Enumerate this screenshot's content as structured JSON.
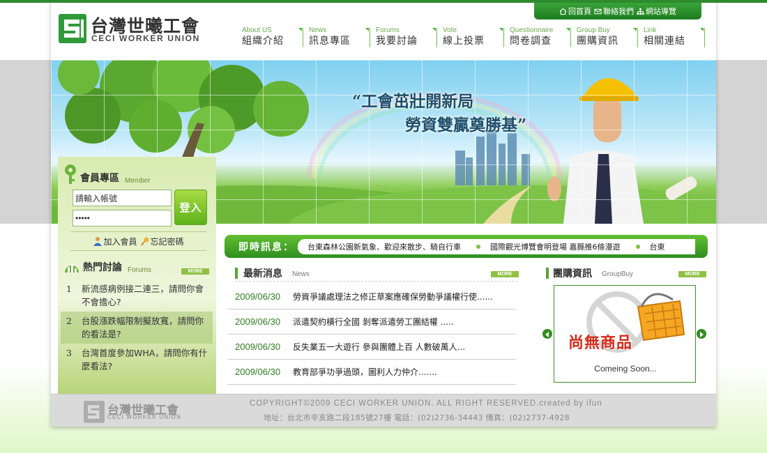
{
  "header": {
    "logo_title": "台灣世曦工會",
    "logo_subtitle": "CECI WORKER UNION",
    "top_links": [
      {
        "label": "回首頁",
        "icon": "home-icon"
      },
      {
        "label": "聯絡我們",
        "icon": "mail-icon"
      },
      {
        "label": "網站導覽",
        "icon": "sitemap-icon"
      }
    ],
    "nav": [
      {
        "en": "About US",
        "zh": "組織介紹"
      },
      {
        "en": "News",
        "zh": "訊息專區"
      },
      {
        "en": "Forums",
        "zh": "我要討論"
      },
      {
        "en": "Vote",
        "zh": "線上投票"
      },
      {
        "en": "Questionnaire",
        "zh": "問卷調查"
      },
      {
        "en": "Group Buy",
        "zh": "團購資訊"
      },
      {
        "en": "Link",
        "zh": "相關連結"
      }
    ]
  },
  "banner": {
    "slogan_line1": "“工會茁壯開新局",
    "slogan_line2": "勞資雙贏奠勝基”"
  },
  "member": {
    "title": "會員專區",
    "title_en": "Member",
    "account_value": "請輸入帳號",
    "password_value": "•••••",
    "login_label": "登入",
    "join_label": "加入會員",
    "forgot_label": "忘記密碼"
  },
  "hot": {
    "title": "熱門討論",
    "title_en": "Forums",
    "more_label": "MORE",
    "items": [
      {
        "num": "1",
        "text": "新流感病例接二連三，請問你會不會擔心?"
      },
      {
        "num": "2",
        "text": "台股漲跌幅限制擬放寬，請問你的看法是?"
      },
      {
        "num": "3",
        "text": "台灣首度參加WHA，請問你有什麼看法?"
      }
    ]
  },
  "ticker": {
    "label": "即時訊息：",
    "items": [
      "台東森林公園新氣象、歡迎來散步、騎自行車",
      "國際觀光博覽會明登場 嘉縣推6條漫遊",
      "台東"
    ]
  },
  "news": {
    "title": "最新消息",
    "title_en": "News",
    "more_label": "MORE",
    "items": [
      {
        "date": "2009/06/30",
        "title": "勞資爭議處理法之修正草案應確保勞動爭議權行使......"
      },
      {
        "date": "2009/06/30",
        "title": "派遣契約橫行全國 剝奪派遣勞工團結權 ....."
      },
      {
        "date": "2009/06/30",
        "title": "反失業五一大遊行 參與團體上百 人數破萬人..."
      },
      {
        "date": "2009/06/30",
        "title": "教育部爭功爭過頭，圖利人力仲介......."
      }
    ]
  },
  "groupbuy": {
    "title": "團購資訊",
    "title_en": "GroupBuy",
    "more_label": "MORE",
    "nothing_label": "尚無商品",
    "soon_label": "Comeing Soon..."
  },
  "footer": {
    "logo_title": "台灣世曦工會",
    "logo_subtitle": "CECI WORKER UNION",
    "copyright": "COPYRIGHT©2009 CECI WORKER UNION. ALL RIGHT RESERVED.created by ifun",
    "address": "地址：台北市辛亥路二段185號27樓 電話：(02)2736-34443 傳真：(02)2737-4928"
  },
  "colors": {
    "brand_green": "#2e8b2e",
    "accent_green": "#62bf33",
    "date_green": "#2e7d1e",
    "sold_out_red": "#d42b1a"
  }
}
